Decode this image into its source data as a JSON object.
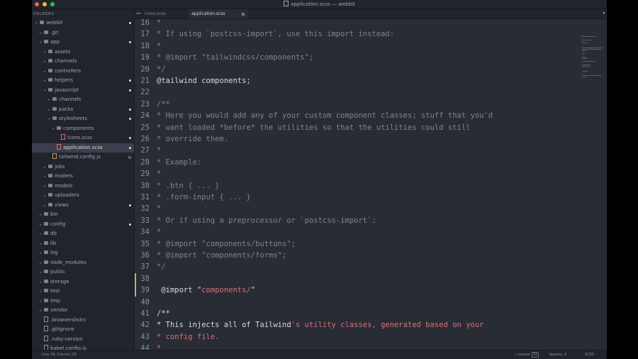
{
  "window": {
    "title": "application.scss — webbit",
    "controls": [
      {
        "name": "close",
        "color": "#ff5f57"
      },
      {
        "name": "minimize",
        "color": "#febc2e"
      },
      {
        "name": "zoom",
        "color": "#28c840"
      }
    ]
  },
  "sidebar": {
    "header": "FOLDERS",
    "items": [
      {
        "label": "webbit",
        "depth": 0,
        "kind": "folder",
        "open": true,
        "dot": "filled"
      },
      {
        "label": ".git",
        "depth": 1,
        "kind": "folder",
        "dot": "none"
      },
      {
        "label": "app",
        "depth": 1,
        "kind": "folder",
        "open": true,
        "dot": "filled"
      },
      {
        "label": "assets",
        "depth": 2,
        "kind": "folder",
        "dot": "none"
      },
      {
        "label": "channels",
        "depth": 2,
        "kind": "folder",
        "dot": "none"
      },
      {
        "label": "controllers",
        "depth": 2,
        "kind": "folder",
        "dot": "none"
      },
      {
        "label": "helpers",
        "depth": 2,
        "kind": "folder",
        "dot": "filled"
      },
      {
        "label": "javascript",
        "depth": 2,
        "kind": "folder",
        "open": true,
        "dot": "filled"
      },
      {
        "label": "channels",
        "depth": 3,
        "kind": "folder",
        "dot": "none"
      },
      {
        "label": "packs",
        "depth": 3,
        "kind": "folder",
        "dot": "filled"
      },
      {
        "label": "stylesheets",
        "depth": 3,
        "kind": "folder",
        "open": true,
        "dot": "filled"
      },
      {
        "label": "components",
        "depth": 4,
        "kind": "folder",
        "open": true,
        "dot": "none"
      },
      {
        "label": "icons.scss",
        "depth": 5,
        "kind": "file",
        "color": "red",
        "dot": "filled"
      },
      {
        "label": "application.scss",
        "depth": 4,
        "kind": "file",
        "color": "red",
        "dot": "filled",
        "selected": true
      },
      {
        "label": "tailwind.config.js",
        "depth": 3,
        "kind": "file",
        "color": "yellow",
        "dot": "hollow"
      },
      {
        "label": "jobs",
        "depth": 2,
        "kind": "folder",
        "dot": "none"
      },
      {
        "label": "mailers",
        "depth": 2,
        "kind": "folder",
        "dot": "none"
      },
      {
        "label": "models",
        "depth": 2,
        "kind": "folder",
        "dot": "none"
      },
      {
        "label": "uploaders",
        "depth": 2,
        "kind": "folder",
        "dot": "none"
      },
      {
        "label": "views",
        "depth": 2,
        "kind": "folder",
        "dot": "filled"
      },
      {
        "label": "bin",
        "depth": 1,
        "kind": "folder",
        "dot": "none"
      },
      {
        "label": "config",
        "depth": 1,
        "kind": "folder",
        "dot": "filled"
      },
      {
        "label": "db",
        "depth": 1,
        "kind": "folder",
        "dot": "none"
      },
      {
        "label": "lib",
        "depth": 1,
        "kind": "folder",
        "dot": "none"
      },
      {
        "label": "log",
        "depth": 1,
        "kind": "folder",
        "dot": "none"
      },
      {
        "label": "node_modules",
        "depth": 1,
        "kind": "folder",
        "dot": "none"
      },
      {
        "label": "public",
        "depth": 1,
        "kind": "folder",
        "dot": "none"
      },
      {
        "label": "storage",
        "depth": 1,
        "kind": "folder",
        "dot": "none"
      },
      {
        "label": "test",
        "depth": 1,
        "kind": "folder",
        "dot": "none"
      },
      {
        "label": "tmp",
        "depth": 1,
        "kind": "folder",
        "dot": "none"
      },
      {
        "label": "vendor",
        "depth": 1,
        "kind": "folder",
        "dot": "none"
      },
      {
        "label": ".browserslistrc",
        "depth": 1,
        "kind": "file",
        "dot": "none"
      },
      {
        "label": ".gitignore",
        "depth": 1,
        "kind": "file",
        "dot": "none"
      },
      {
        "label": ".ruby-version",
        "depth": 1,
        "kind": "file",
        "dot": "none"
      },
      {
        "label": "babel.config.js",
        "depth": 1,
        "kind": "file",
        "dot": "none"
      }
    ]
  },
  "tabs": {
    "arrows": "◂ ▸",
    "items": [
      {
        "label": "icons.scss",
        "active": false
      },
      {
        "label": "application.scss",
        "active": true,
        "modified": true
      }
    ],
    "dropdown": "▾"
  },
  "editor": {
    "lines": [
      {
        "n": "16",
        "segs": [
          {
            "t": "*",
            "c": "cm"
          }
        ]
      },
      {
        "n": "17",
        "segs": [
          {
            "t": "* If using `postcss-import`, use this import instead:",
            "c": "cm"
          }
        ]
      },
      {
        "n": "18",
        "segs": [
          {
            "t": "*",
            "c": "cm"
          }
        ]
      },
      {
        "n": "19",
        "segs": [
          {
            "t": "* @import \"tailwindcss/components\";",
            "c": "cm"
          }
        ]
      },
      {
        "n": "20",
        "segs": [
          {
            "t": "*/",
            "c": "cm"
          }
        ]
      },
      {
        "n": "21",
        "segs": [
          {
            "t": "@tailwind components;",
            "c": "tx"
          }
        ]
      },
      {
        "n": "22",
        "segs": []
      },
      {
        "n": "23",
        "segs": [
          {
            "t": "/**",
            "c": "cm"
          }
        ]
      },
      {
        "n": "24",
        "segs": [
          {
            "t": "* Here you would add any of your custom component classes; stuff that you'd",
            "c": "cm"
          }
        ]
      },
      {
        "n": "25",
        "segs": [
          {
            "t": "* want loaded *before* the utilities so that the utilities could still",
            "c": "cm"
          }
        ]
      },
      {
        "n": "26",
        "segs": [
          {
            "t": "* override them.",
            "c": "cm"
          }
        ]
      },
      {
        "n": "27",
        "segs": [
          {
            "t": "*",
            "c": "cm"
          }
        ]
      },
      {
        "n": "28",
        "segs": [
          {
            "t": "* Example:",
            "c": "cm"
          }
        ]
      },
      {
        "n": "29",
        "segs": [
          {
            "t": "*",
            "c": "cm"
          }
        ]
      },
      {
        "n": "30",
        "segs": [
          {
            "t": "* .btn { ... }",
            "c": "cm"
          }
        ]
      },
      {
        "n": "31",
        "segs": [
          {
            "t": "* .form-input { ... }",
            "c": "cm"
          }
        ]
      },
      {
        "n": "32",
        "segs": [
          {
            "t": "*",
            "c": "cm"
          }
        ]
      },
      {
        "n": "33",
        "segs": [
          {
            "t": "* Or if using a preprocessor or `postcss-import`:",
            "c": "cm"
          }
        ]
      },
      {
        "n": "34",
        "segs": [
          {
            "t": "*",
            "c": "cm"
          }
        ]
      },
      {
        "n": "35",
        "segs": [
          {
            "t": "* @import \"components/buttons\";",
            "c": "cm"
          }
        ]
      },
      {
        "n": "36",
        "segs": [
          {
            "t": "* @import \"components/forms\";",
            "c": "cm"
          }
        ]
      },
      {
        "n": "37",
        "segs": [
          {
            "t": "*/",
            "c": "cm"
          }
        ]
      },
      {
        "n": "38",
        "segs": [],
        "diff": true
      },
      {
        "n": "39",
        "segs": [
          {
            "t": " @import ",
            "c": "tx"
          },
          {
            "t": "\"",
            "c": "tx"
          },
          {
            "t": "components/",
            "c": "str"
          },
          {
            "t": "\"",
            "c": "tx"
          }
        ],
        "diff": true,
        "current": true
      },
      {
        "n": "40",
        "segs": []
      },
      {
        "n": "41",
        "segs": [
          {
            "t": "/**",
            "c": "tx"
          }
        ]
      },
      {
        "n": "42",
        "segs": [
          {
            "t": "* This injects all of Tailwind",
            "c": "tx"
          },
          {
            "t": "'s utility classes, generated based on your",
            "c": "str"
          }
        ]
      },
      {
        "n": "43",
        "segs": [
          {
            "t": "* config file.",
            "c": "str"
          }
        ]
      },
      {
        "n": "44",
        "segs": [
          {
            "t": "*",
            "c": "str"
          }
        ]
      }
    ]
  },
  "statusbar": {
    "position": "Line 39, Column 23",
    "branch": "master",
    "branch_count": "31",
    "indent": "Spaces: 2",
    "syntax": "SCSS"
  },
  "colors": {
    "editor_bg": "#282c34",
    "sidebar_bg": "#21252b",
    "string": "#e06c75",
    "comment": "#7f848e",
    "git_added": "#98c379"
  }
}
